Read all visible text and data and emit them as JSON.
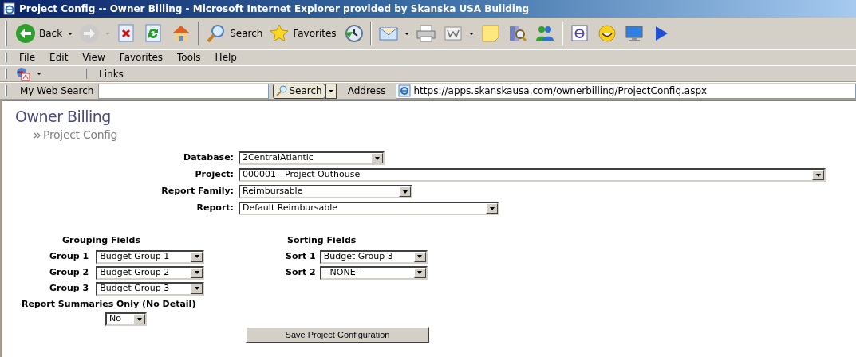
{
  "window": {
    "title": "Project Config -- Owner Billing - Microsoft Internet Explorer provided by Skanska USA Building"
  },
  "toolbar": [
    {
      "kind": "back",
      "label": "Back",
      "dropdown": true,
      "disabled": false
    },
    {
      "kind": "forward",
      "dropdown": true,
      "disabled": true
    },
    {
      "kind": "stop",
      "dropdown": false,
      "disabled": false
    },
    {
      "kind": "refresh",
      "dropdown": false,
      "disabled": false
    },
    {
      "kind": "home",
      "dropdown": false,
      "disabled": false
    },
    {
      "kind": "separator"
    },
    {
      "kind": "search",
      "label": "Search",
      "dropdown": false,
      "disabled": false
    },
    {
      "kind": "favorites",
      "label": "Favorites",
      "dropdown": false,
      "disabled": false
    },
    {
      "kind": "history",
      "dropdown": false,
      "disabled": false
    },
    {
      "kind": "separator"
    },
    {
      "kind": "mail",
      "dropdown": true,
      "disabled": false
    },
    {
      "kind": "print",
      "dropdown": false,
      "disabled": false
    },
    {
      "kind": "edit",
      "dropdown": true,
      "disabled": false
    },
    {
      "kind": "note",
      "dropdown": false,
      "disabled": false
    },
    {
      "kind": "research",
      "dropdown": false,
      "disabled": false
    },
    {
      "kind": "messenger",
      "dropdown": false,
      "disabled": false
    },
    {
      "kind": "separator"
    },
    {
      "kind": "browser",
      "dropdown": false,
      "disabled": false
    },
    {
      "kind": "smiley",
      "dropdown": false,
      "disabled": false
    },
    {
      "kind": "monitor",
      "dropdown": false,
      "disabled": false
    },
    {
      "kind": "pointer",
      "dropdown": false,
      "disabled": false
    }
  ],
  "menu": [
    "File",
    "Edit",
    "View",
    "Favorites",
    "Tools",
    "Help"
  ],
  "links_bar": {
    "label": "Links"
  },
  "search_bar": {
    "label": "My Web Search",
    "button": "Search"
  },
  "address_bar": {
    "label": "Address",
    "value": "https://apps.skanskausa.com/ownerbilling/ProjectConfig.aspx"
  },
  "page": {
    "heading": "Owner Billing",
    "subheading": "Project Config",
    "fields": [
      {
        "label": "Database:",
        "value": "2CentralAtlantic"
      },
      {
        "label": "Project:",
        "value": "000001 - Project Outhouse"
      },
      {
        "label": "Report Family:",
        "value": "Reimbursable"
      },
      {
        "label": "Report:",
        "value": "Default Reimbursable"
      }
    ],
    "grouping": {
      "title": "Grouping Fields",
      "rows": [
        {
          "label": "Group 1",
          "value": "Budget Group 1"
        },
        {
          "label": "Group 2",
          "value": "Budget Group 2"
        },
        {
          "label": "Group 3",
          "value": "Budget Group 3"
        }
      ]
    },
    "sorting": {
      "title": "Sorting Fields",
      "rows": [
        {
          "label": "Sort 1",
          "value": "Budget Group 3"
        },
        {
          "label": "Sort 2",
          "value": "--NONE--"
        }
      ]
    },
    "summary": {
      "label": "Report Summaries Only (No Detail)",
      "value": "No"
    },
    "save_button": "Save Project Configuration"
  }
}
